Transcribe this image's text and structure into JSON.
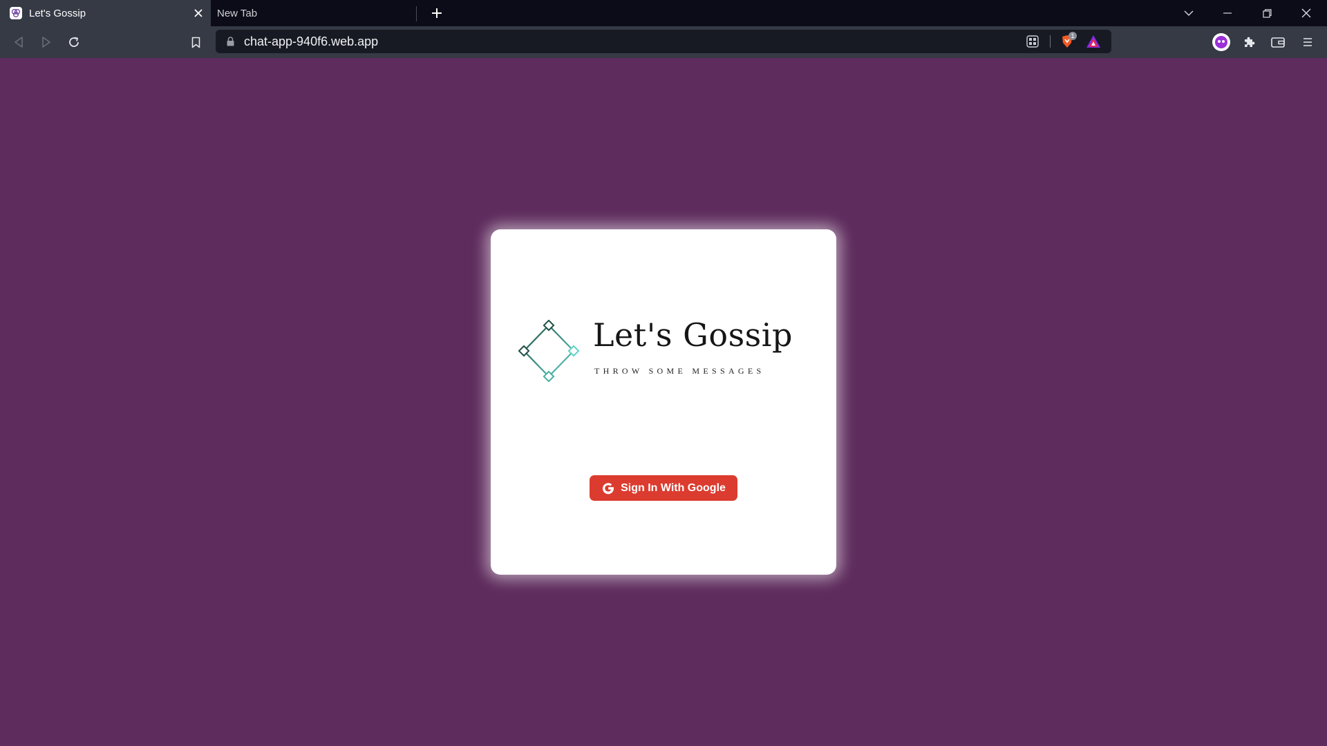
{
  "browser": {
    "tabs": [
      {
        "title": "Let's Gossip",
        "active": true
      },
      {
        "title": "New Tab",
        "active": false
      }
    ],
    "url": "chat-app-940f6.web.app",
    "shield_count": "1"
  },
  "login_card": {
    "brand_title": "Let's Gossip",
    "tagline": "THROW SOME MESSAGES",
    "signin_button": "Sign In With Google"
  },
  "colors": {
    "page_background": "#5e2c5d",
    "signin_button": "#dc3b2f",
    "logo_dark": "#1f4f46",
    "logo_light": "#5ed3c4"
  },
  "icons": [
    "favicon-icon",
    "close-icon",
    "plus-icon",
    "chevron-down-icon",
    "minimize-icon",
    "restore-icon",
    "close-window-icon",
    "back-icon",
    "forward-icon",
    "reload-icon",
    "bookmark-icon",
    "lock-icon",
    "qr-icon",
    "brave-shield-icon",
    "brave-rewards-icon",
    "profile-icon",
    "extensions-icon",
    "wallet-icon",
    "menu-icon",
    "google-g-icon"
  ]
}
